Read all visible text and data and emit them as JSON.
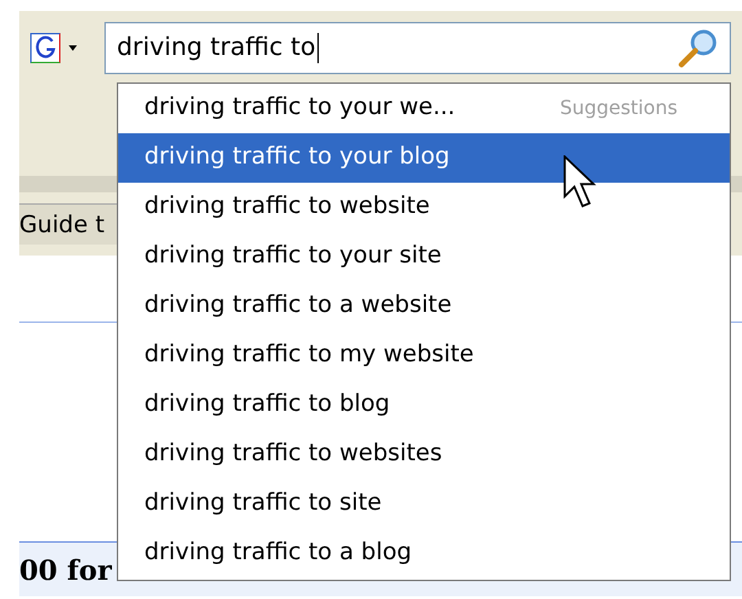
{
  "search": {
    "value": "driving traffic to"
  },
  "tab": {
    "label": "Guide t"
  },
  "results_bar": {
    "text": "00 for"
  },
  "dropdown": {
    "header": "Suggestions",
    "items": [
      {
        "label": "driving traffic to your we...",
        "selected": false
      },
      {
        "label": "driving traffic to your blog",
        "selected": true
      },
      {
        "label": "driving traffic to website",
        "selected": false
      },
      {
        "label": "driving traffic to your site",
        "selected": false
      },
      {
        "label": "driving traffic to a website",
        "selected": false
      },
      {
        "label": "driving traffic to my website",
        "selected": false
      },
      {
        "label": "driving traffic to blog",
        "selected": false
      },
      {
        "label": "driving traffic to websites",
        "selected": false
      },
      {
        "label": "driving traffic to site",
        "selected": false
      },
      {
        "label": "driving traffic to a blog",
        "selected": false
      }
    ]
  }
}
